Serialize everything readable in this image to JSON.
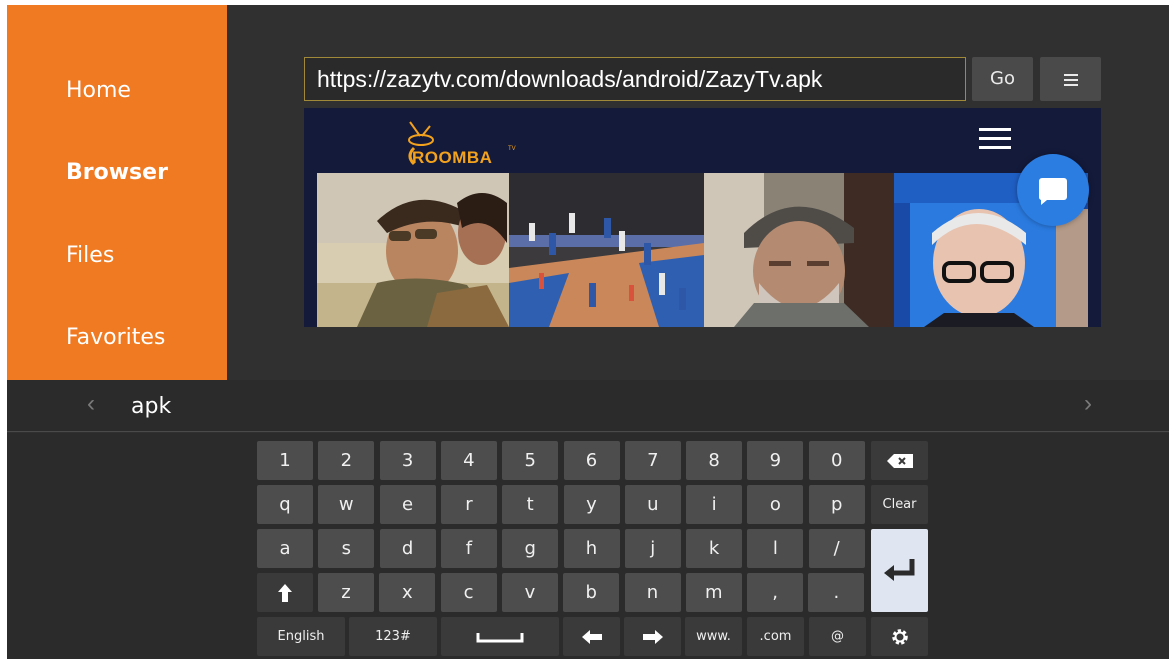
{
  "sidebar": {
    "items": [
      {
        "label": "Home"
      },
      {
        "label": "Browser",
        "active": true
      },
      {
        "label": "Files"
      },
      {
        "label": "Favorites"
      }
    ],
    "color": "#f07a21"
  },
  "browser": {
    "url": "https://zazytv.com/downloads/android/ZazyTv.apk",
    "go_label": "Go",
    "menu_icon": "hamburger-icon",
    "site": {
      "logo_text": "ROOMBA",
      "logo_tm": "TV",
      "menu_icon": "hamburger-icon",
      "chat_icon": "chat-bubble-icon"
    }
  },
  "suggestion": {
    "text": "apk",
    "prev_icon": "chevron-left-icon",
    "next_icon": "chevron-right-icon"
  },
  "keyboard": {
    "row1": [
      "1",
      "2",
      "3",
      "4",
      "5",
      "6",
      "7",
      "8",
      "9",
      "0"
    ],
    "row2": [
      "q",
      "w",
      "e",
      "r",
      "t",
      "y",
      "u",
      "i",
      "o",
      "p"
    ],
    "row3": [
      "a",
      "s",
      "d",
      "f",
      "g",
      "h",
      "j",
      "k",
      "l",
      "/"
    ],
    "row4": [
      "z",
      "x",
      "c",
      "v",
      "b",
      "n",
      "m",
      ",",
      "."
    ],
    "clear_label": "Clear",
    "language_label": "English",
    "symbols_label": "123#",
    "www_label": "www.",
    "com_label": ".com",
    "at_label": "@"
  }
}
